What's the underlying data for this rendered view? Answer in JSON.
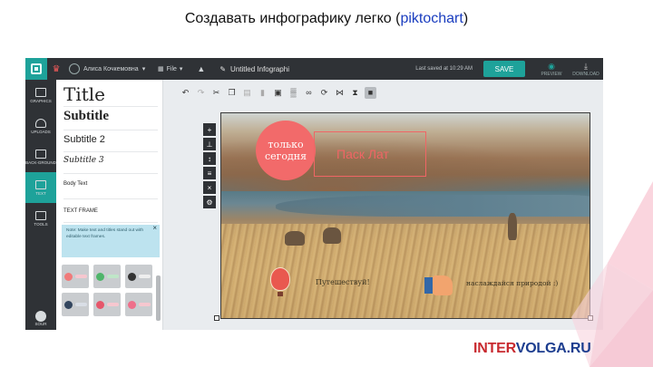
{
  "slide": {
    "title_before": "Создавать инфографику легко (",
    "title_link": "piktochart",
    "title_after": ")"
  },
  "topbar": {
    "user_name": "Алиса Кочкемовна",
    "file_label": "File",
    "doc_title": "Untitled Infographi",
    "saved_text": "Last saved at 10:29 AM",
    "save_label": "SAVE",
    "preview_label": "PREVIEW",
    "download_label": "DOWNLOAD"
  },
  "rail": {
    "items": [
      {
        "label": "GRAPHICS",
        "icon": "image-icon"
      },
      {
        "label": "UPLOADS",
        "icon": "cloud-upload-icon"
      },
      {
        "label": "BACK-GROUND",
        "icon": "monitor-icon"
      },
      {
        "label": "TEXT",
        "icon": "text-icon"
      },
      {
        "label": "TOOLS",
        "icon": "toolbox-icon"
      }
    ],
    "bottom_label": "SOUR"
  },
  "panel": {
    "title": "Title",
    "subtitle": "Subtitle",
    "subtitle2": "Subtitle 2",
    "subtitle3": "Subtitle 3",
    "body_text": "Body Text",
    "text_frame": "TEXT FRAME",
    "note": "Note: Make text and titles stand out with editable text frames.",
    "note_close": "×"
  },
  "toolbar": {
    "tools": [
      "undo-icon",
      "redo-icon",
      "cut-icon",
      "copy-icon",
      "paste-icon",
      "delete-icon",
      "lock-icon",
      "opacity-icon",
      "link-icon",
      "rotate-icon",
      "flip-horizontal-icon",
      "flip-vertical-icon",
      "arrange-icon"
    ]
  },
  "canvas": {
    "badge_text": "только сегодня",
    "label_text": "Паск  Лат",
    "caption1": "Путешествуй!",
    "caption2": "наслаждайся природой :)"
  },
  "brand": {
    "part1": "INTER",
    "part2": "VOLGA.RU"
  },
  "colors": {
    "accent": "#1ea29a",
    "dark_bar": "#2f3236",
    "badge": "#f26a6a",
    "brand_red": "#c8292f",
    "brand_blue": "#1c3d8f"
  }
}
